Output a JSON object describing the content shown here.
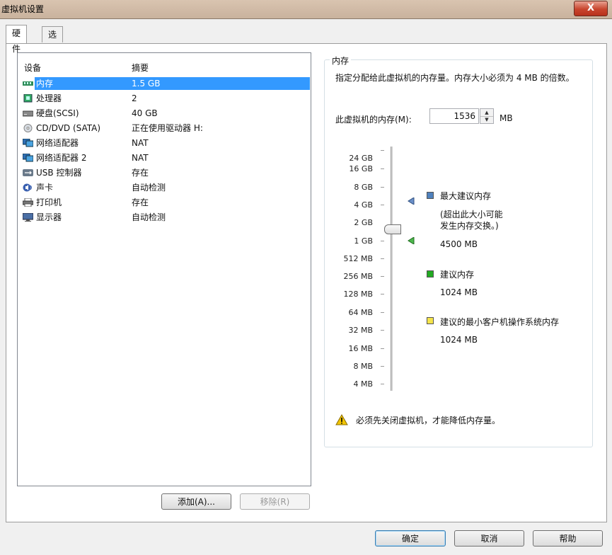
{
  "window": {
    "title": "虚拟机设置",
    "close_label": "X"
  },
  "tabs": [
    {
      "label": "硬件",
      "active": true
    },
    {
      "label": "选项",
      "active": false
    }
  ],
  "device_list": {
    "headers": {
      "device": "设备",
      "summary": "摘要"
    },
    "rows": [
      {
        "name": "内存",
        "summary": "1.5 GB",
        "icon": "memory-icon",
        "selected": true
      },
      {
        "name": "处理器",
        "summary": "2",
        "icon": "processor-icon"
      },
      {
        "name": "硬盘(SCSI)",
        "summary": "40 GB",
        "icon": "hard-disk-icon"
      },
      {
        "name": "CD/DVD (SATA)",
        "summary": "正在使用驱动器 H:",
        "icon": "cd-dvd-icon"
      },
      {
        "name": "网络适配器",
        "summary": "NAT",
        "icon": "network-adapter-icon"
      },
      {
        "name": "网络适配器 2",
        "summary": "NAT",
        "icon": "network-adapter-icon"
      },
      {
        "name": "USB 控制器",
        "summary": "存在",
        "icon": "usb-icon"
      },
      {
        "name": "声卡",
        "summary": "自动检测",
        "icon": "sound-card-icon"
      },
      {
        "name": "打印机",
        "summary": "存在",
        "icon": "printer-icon"
      },
      {
        "name": "显示器",
        "summary": "自动检测",
        "icon": "display-icon"
      }
    ]
  },
  "buttons": {
    "add": "添加(A)...",
    "remove": "移除(R)",
    "ok": "确定",
    "cancel": "取消",
    "help": "帮助"
  },
  "memory": {
    "group_title": "内存",
    "description": "指定分配给此虚拟机的内存量。内存大小必须为 4 MB 的倍数。",
    "memory_label": "此虚拟机的内存(M):",
    "memory_value": "1536",
    "unit": "MB",
    "scale_labels": [
      "24 GB",
      "16 GB",
      "8 GB",
      "4 GB",
      "2 GB",
      "1 GB",
      "512 MB",
      "256 MB",
      "128 MB",
      "64 MB",
      "32 MB",
      "16 MB",
      "8 MB",
      "4 MB"
    ],
    "legend": {
      "max_title": "最大建议内存",
      "max_note_1": "(超出此大小可能",
      "max_note_2": "发生内存交换。)",
      "max_value": "4500 MB",
      "rec_title": "建议内存",
      "rec_value": "1024 MB",
      "min_title": "建议的最小客户机操作系统内存",
      "min_value": "1024 MB"
    },
    "legend_colors": {
      "max": "#4f81bd",
      "recommended": "#22aa22",
      "minimum": "#f5e44a"
    },
    "warning": "必须先关闭虚拟机，才能降低内存量。"
  }
}
